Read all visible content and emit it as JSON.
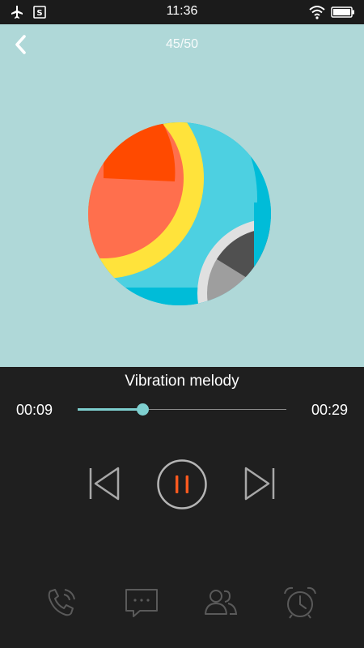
{
  "status_bar": {
    "time": "11:36"
  },
  "header": {
    "track_counter": "45/50"
  },
  "player": {
    "song_title": "Vibration melody",
    "elapsed": "00:09",
    "total": "00:29",
    "progress_fraction": 0.31,
    "state": "playing"
  },
  "colors": {
    "hero_background": "#afd8d8",
    "accent": "#7ecfcf",
    "pause_icon": "#ff5a1f",
    "player_background": "#1f1f1f"
  },
  "bottom_nav": {
    "items": [
      {
        "icon": "phone-icon"
      },
      {
        "icon": "message-icon"
      },
      {
        "icon": "contacts-icon"
      },
      {
        "icon": "alarm-clock-icon"
      }
    ]
  }
}
